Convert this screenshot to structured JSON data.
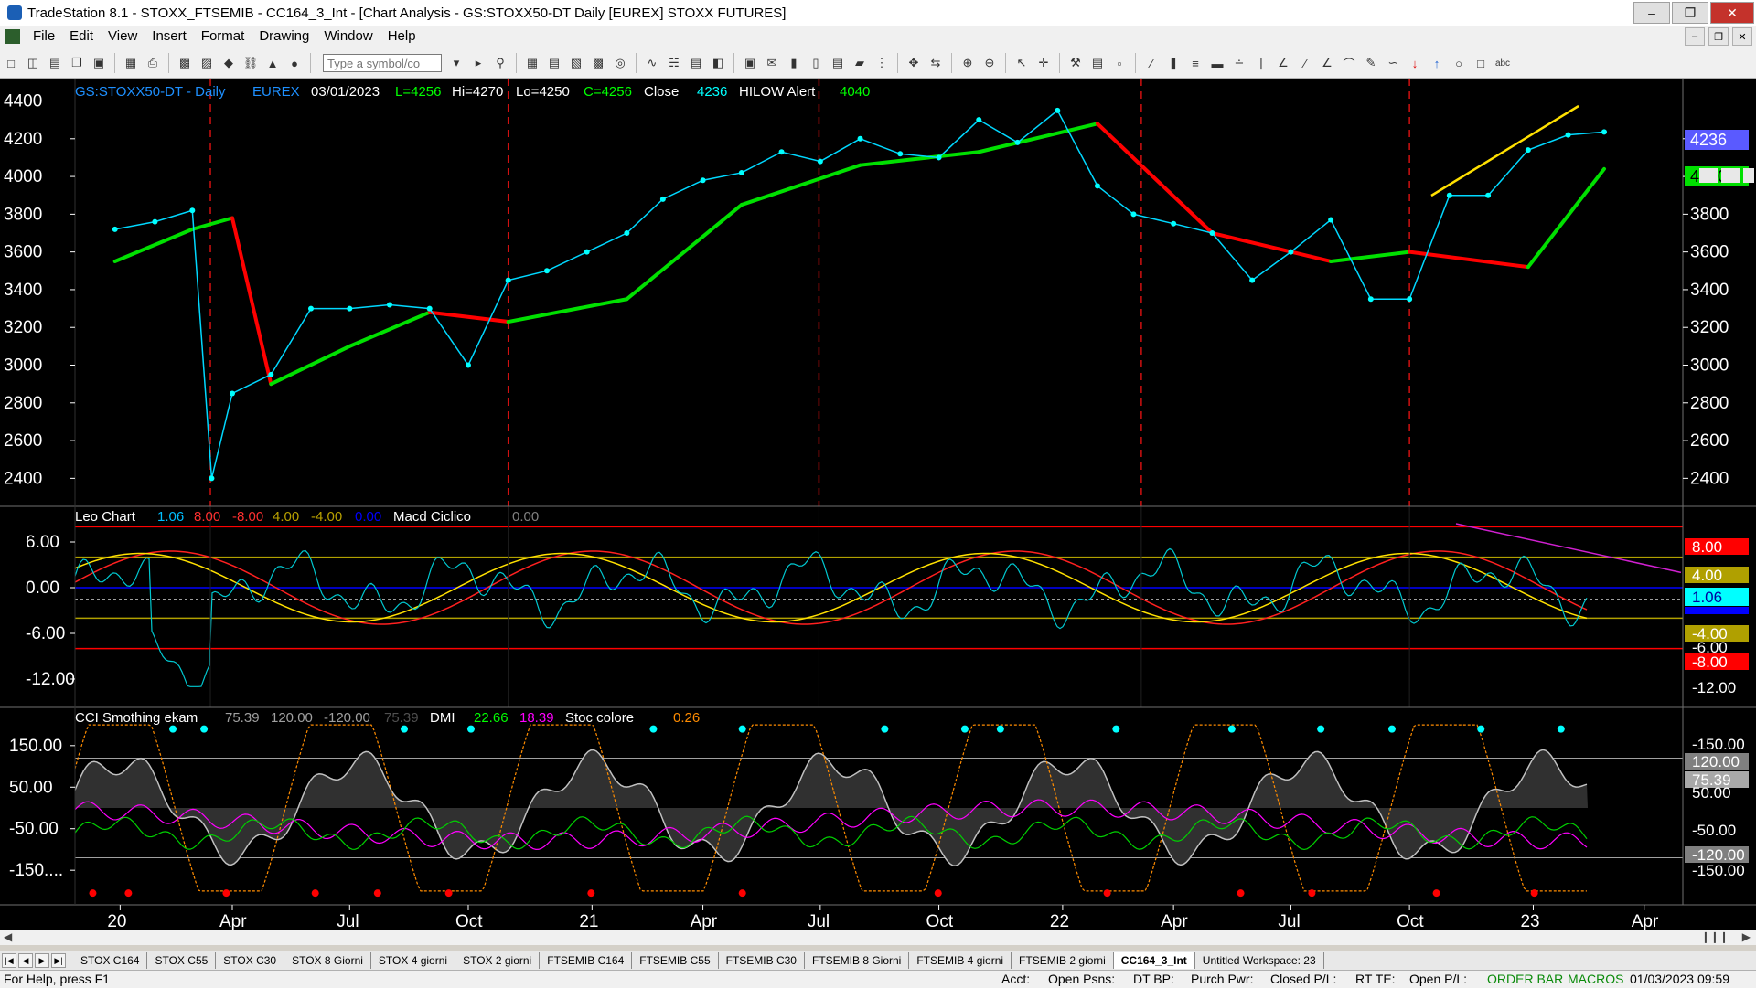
{
  "window": {
    "title": "TradeStation 8.1 - STOXX_FTSEMIB - CC164_3_Int - [Chart Analysis - GS:STOXX50-DT  Daily  [EUREX] STOXX FUTURES]"
  },
  "menu": [
    "File",
    "Edit",
    "View",
    "Insert",
    "Format",
    "Drawing",
    "Window",
    "Help"
  ],
  "toolbar": {
    "symbol_placeholder": "Type a symbol/co"
  },
  "price_panel": {
    "symbol": "GS:STOXX50-DT - Daily",
    "exchange": "EUREX",
    "date": "03/01/2023",
    "last": "L=4256",
    "high": "Hi=4270",
    "low": "Lo=4250",
    "close": "C=4256",
    "close_label": "Close",
    "close_value": "4236",
    "alert_label": "HILOW Alert",
    "alert_value": "4040",
    "y_ticks": [
      "4400",
      "4200",
      "4000",
      "3800",
      "3600",
      "3400",
      "3200",
      "3000",
      "2800",
      "2600",
      "2400"
    ],
    "tag_close": "4236",
    "tag_alert": "4040"
  },
  "osc_panel": {
    "title": "Leo Chart",
    "v1": "1.06",
    "v2": "8.00",
    "v3": "-8.00",
    "v4": "4.00",
    "v5": "-4.00",
    "v6": "0.00",
    "macd_label": "Macd Ciclico",
    "macd_value": "0.00",
    "y_ticks": [
      "6.00",
      "0.00",
      "-6.00",
      "-12.00"
    ],
    "tag_8": "8.00",
    "tag_4": "4.00",
    "tag_106": "1.06",
    "tag_m4": "-4.00",
    "tag_m6": "-6.00",
    "tag_m8": "-8.00",
    "tag_m12": "-12.00"
  },
  "cci_panel": {
    "title": "CCI Smothing ekam",
    "v1": "75.39",
    "v2": "120.00",
    "v3": "-120.00",
    "v4": "75.39",
    "dmi_label": "DMI",
    "dmi_plus": "22.66",
    "dmi_minus": "18.39",
    "stoc_label": "Stoc colore",
    "stoc_value": "0.26",
    "y_ticks": [
      "150.00",
      "50.00",
      "-50.00",
      "-150...."
    ],
    "right_ticks": [
      "-150.00",
      "50.00",
      "-50.00",
      "-150.00"
    ],
    "tag_120": "120.00",
    "tag_7539": "75.39",
    "tag_m120": "-120.00"
  },
  "x_axis": [
    "20",
    "Apr",
    "Jul",
    "Oct",
    "21",
    "Apr",
    "Jul",
    "Oct",
    "22",
    "Apr",
    "Jul",
    "Oct",
    "23",
    "Apr"
  ],
  "tabs": [
    "STOX C164",
    "STOX C55",
    "STOX  C30",
    "STOX  8 Giorni",
    "STOX 4 giorni",
    "STOX  2 giorni",
    "FTSEMIB C164",
    "FTSEMIB C55",
    "FTSEMIB C30",
    "FTSEMIB  8 Giorni",
    "FTSEMIB  4 giorni",
    "FTSEMIB  2 giorni",
    "CC164_3_Int",
    "Untitled Workspace: 23"
  ],
  "status": {
    "help": "For Help, press F1",
    "acct": "Acct:",
    "open_psns": "Open Psns:",
    "dt_bp": "DT BP:",
    "purch_pwr": "Purch Pwr:",
    "closed_pl": "Closed P/L:",
    "rt_te": "RT TE:",
    "open_pl": "Open P/L:",
    "order_bar": "ORDER BAR",
    "macros": "MACROS",
    "datetime": "01/03/2023 09:59"
  },
  "chart_data": {
    "type": "line",
    "price_series": {
      "name": "Close",
      "dates": [
        "2020-01",
        "2020-02",
        "2020-03",
        "2020-03-16",
        "2020-04",
        "2020-05",
        "2020-06",
        "2020-07",
        "2020-08",
        "2020-09",
        "2020-10",
        "2020-11",
        "2020-12",
        "2021-01",
        "2021-02",
        "2021-03",
        "2021-04",
        "2021-05",
        "2021-06",
        "2021-07",
        "2021-08",
        "2021-09",
        "2021-10",
        "2021-11",
        "2021-12",
        "2022-01",
        "2022-02",
        "2022-03",
        "2022-04",
        "2022-05",
        "2022-06",
        "2022-07",
        "2022-08",
        "2022-09",
        "2022-10",
        "2022-11",
        "2022-12",
        "2023-01",
        "2023-02",
        "2023-03-01"
      ],
      "values": [
        3720,
        3760,
        3820,
        2400,
        2850,
        2950,
        3300,
        3300,
        3320,
        3300,
        3000,
        3450,
        3500,
        3600,
        3700,
        3880,
        3980,
        4020,
        4130,
        4080,
        4200,
        4120,
        4100,
        4300,
        4180,
        4350,
        3950,
        3800,
        3750,
        3700,
        3450,
        3600,
        3770,
        3350,
        3350,
        3900,
        3900,
        4140,
        4220,
        4236
      ]
    },
    "alert_series": {
      "name": "HILOW Alert",
      "dates": [
        "2020-01",
        "2020-03",
        "2020-04",
        "2020-05",
        "2020-07",
        "2020-09",
        "2020-11",
        "2021-02",
        "2021-05",
        "2021-08",
        "2021-11",
        "2022-02",
        "2022-05",
        "2022-08",
        "2022-10",
        "2023-01",
        "2023-03-01"
      ],
      "values": [
        3550,
        3720,
        3780,
        2900,
        3100,
        3280,
        3230,
        3350,
        3850,
        4060,
        4130,
        4280,
        3700,
        3550,
        3600,
        3520,
        4040
      ]
    },
    "y_range": [
      2300,
      4480
    ],
    "osc_range": [
      -15,
      9
    ],
    "cci_range": [
      -220,
      220
    ]
  }
}
